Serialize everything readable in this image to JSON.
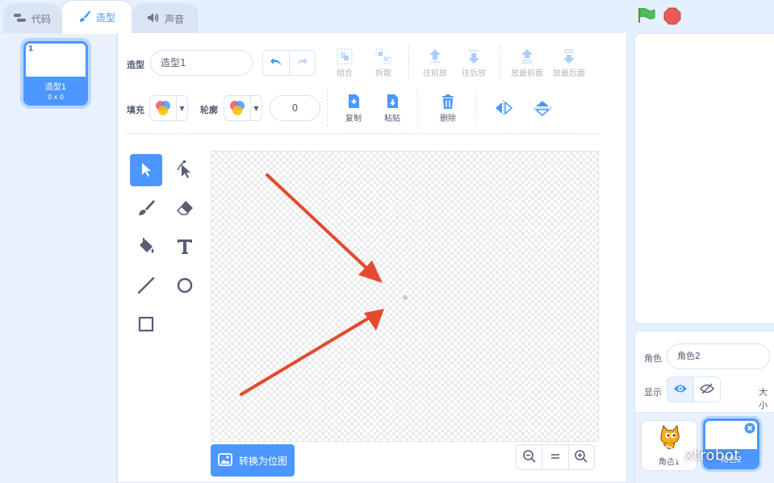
{
  "tabs": [
    {
      "label": "代码",
      "icon": "code-icon"
    },
    {
      "label": "造型",
      "icon": "brush-icon",
      "active": true
    },
    {
      "label": "声音",
      "icon": "speaker-icon"
    }
  ],
  "costumes": [
    {
      "number": "1",
      "name": "造型1",
      "size": "0 x 0",
      "selected": true
    }
  ],
  "toolbar": {
    "costume_label": "造型",
    "costume_name": "造型1",
    "group": "组合",
    "ungroup": "拆散",
    "forward": "往前放",
    "backward": "往后放",
    "front": "放最前面",
    "back": "放最后面",
    "fill_label": "填充",
    "outline_label": "轮廓",
    "outline_width": "0",
    "copy": "复制",
    "paste": "粘贴",
    "delete": "删除"
  },
  "canvas": {
    "convert_button": "转换为位图"
  },
  "sprite_info": {
    "sprite_label": "角色",
    "sprite_name": "角色2",
    "show_label": "显示",
    "size_label": "大小"
  },
  "sprites": [
    {
      "name": "角色1",
      "selected": false
    },
    {
      "name": "角色2",
      "selected": true
    }
  ],
  "watermark": "xtrobot",
  "colors": {
    "accent": "#4c97ff",
    "green_flag": "#4cbf56",
    "stop": "#ec5959",
    "annotation_arrow": "#e34a2f"
  }
}
